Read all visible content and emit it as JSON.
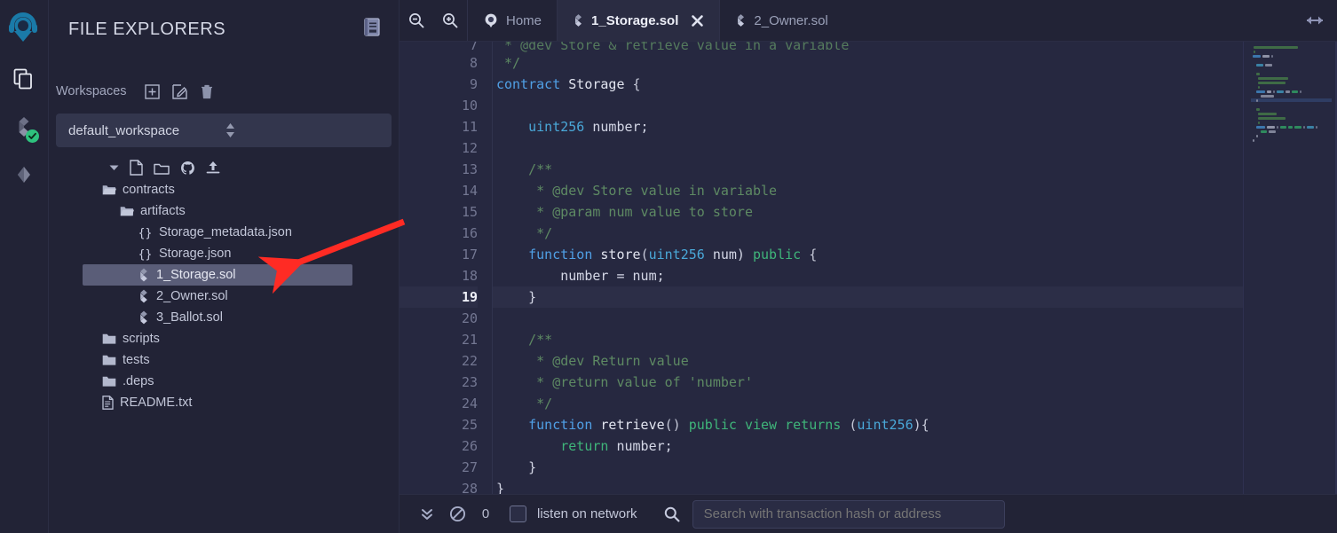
{
  "app": {
    "logo_icon": "remix-logo-icon",
    "accent_color": "#1a7aa8",
    "bg_color": "#222336",
    "editor_bg": "#262840",
    "selected_row_color": "#5a5d78",
    "annotation_arrow_color": "#ff2b24"
  },
  "iconbar": {
    "items": [
      {
        "name": "file-explorers-icon",
        "icon": "files-icon",
        "active": true,
        "badge": null
      },
      {
        "name": "solidity-compiler-icon",
        "icon": "solidity-icon",
        "active": false,
        "badge": "check"
      },
      {
        "name": "deploy-run-transactions-icon",
        "icon": "ethereum-icon",
        "active": false,
        "badge": null
      }
    ]
  },
  "explorer": {
    "title": "FILE EXPLORERS",
    "header_icon": "documentation-book-icon",
    "workspaces_label": "Workspaces",
    "workspace_actions": [
      {
        "name": "create-workspace-button",
        "icon": "plus-square-icon"
      },
      {
        "name": "rename-workspace-button",
        "icon": "pencil-square-icon"
      },
      {
        "name": "delete-workspace-button",
        "icon": "trash-icon"
      }
    ],
    "selected_workspace": "default_workspace",
    "tree_toolbar": [
      {
        "name": "new-file-button",
        "icon": "file-icon"
      },
      {
        "name": "new-folder-button",
        "icon": "folder-icon"
      },
      {
        "name": "connect-github-button",
        "icon": "github-icon"
      },
      {
        "name": "publish-to-gist-button",
        "icon": "upload-icon"
      }
    ],
    "tree": [
      {
        "label": "contracts",
        "type": "folder-open",
        "indent": 1,
        "selected": false
      },
      {
        "label": "artifacts",
        "type": "folder-open",
        "indent": 2,
        "selected": false
      },
      {
        "label": "Storage_metadata.json",
        "type": "json",
        "indent": 3,
        "selected": false
      },
      {
        "label": "Storage.json",
        "type": "json",
        "indent": 3,
        "selected": false
      },
      {
        "label": "1_Storage.sol",
        "type": "solidity",
        "indent": 3,
        "selected": true
      },
      {
        "label": "2_Owner.sol",
        "type": "solidity",
        "indent": 3,
        "selected": false
      },
      {
        "label": "3_Ballot.sol",
        "type": "solidity",
        "indent": 3,
        "selected": false
      },
      {
        "label": "scripts",
        "type": "folder",
        "indent": 1,
        "selected": false
      },
      {
        "label": "tests",
        "type": "folder",
        "indent": 1,
        "selected": false
      },
      {
        "label": ".deps",
        "type": "folder",
        "indent": 1,
        "selected": false
      },
      {
        "label": "README.txt",
        "type": "file",
        "indent": 1,
        "selected": false
      }
    ]
  },
  "tabbar": {
    "zoom_out_icon": "zoom-out-icon",
    "zoom_in_icon": "zoom-in-icon",
    "resize_icon": "horizontal-resize-icon",
    "tabs": [
      {
        "label": "Home",
        "icon": "home-icon",
        "active": false,
        "closable": false
      },
      {
        "label": "1_Storage.sol",
        "icon": "solidity-icon",
        "active": true,
        "closable": true
      },
      {
        "label": "2_Owner.sol",
        "icon": "solidity-icon",
        "active": false,
        "closable": false
      }
    ]
  },
  "editor": {
    "current_line": 19,
    "first_visible_line": 7,
    "lines": [
      {
        "n": 7,
        "partial": true,
        "tokens": [
          {
            "t": " * @dev Store & retrieve value in a variable",
            "c": "c-com"
          }
        ]
      },
      {
        "n": 8,
        "tokens": [
          {
            "t": " */",
            "c": "c-com"
          }
        ]
      },
      {
        "n": 9,
        "tokens": [
          {
            "t": "contract",
            "c": "c-kw"
          },
          {
            "t": " ",
            "c": "c-id"
          },
          {
            "t": "Storage",
            "c": "c-fn"
          },
          {
            "t": " {",
            "c": "c-pun"
          }
        ]
      },
      {
        "n": 10,
        "tokens": []
      },
      {
        "n": 11,
        "tokens": [
          {
            "t": "    ",
            "c": "c-id"
          },
          {
            "t": "uint256",
            "c": "c-type"
          },
          {
            "t": " number;",
            "c": "c-id"
          }
        ]
      },
      {
        "n": 12,
        "tokens": []
      },
      {
        "n": 13,
        "tokens": [
          {
            "t": "    /**",
            "c": "c-com"
          }
        ]
      },
      {
        "n": 14,
        "tokens": [
          {
            "t": "     * @dev Store value in variable",
            "c": "c-com"
          }
        ]
      },
      {
        "n": 15,
        "tokens": [
          {
            "t": "     * @param num value to store",
            "c": "c-com"
          }
        ]
      },
      {
        "n": 16,
        "tokens": [
          {
            "t": "     */",
            "c": "c-com"
          }
        ]
      },
      {
        "n": 17,
        "tokens": [
          {
            "t": "    ",
            "c": "c-id"
          },
          {
            "t": "function",
            "c": "c-kw"
          },
          {
            "t": " ",
            "c": "c-id"
          },
          {
            "t": "store",
            "c": "c-fn"
          },
          {
            "t": "(",
            "c": "c-pun"
          },
          {
            "t": "uint256",
            "c": "c-type"
          },
          {
            "t": " num) ",
            "c": "c-id"
          },
          {
            "t": "public",
            "c": "c-mod"
          },
          {
            "t": " {",
            "c": "c-pun"
          }
        ]
      },
      {
        "n": 18,
        "tokens": [
          {
            "t": "        number = num;",
            "c": "c-id"
          }
        ]
      },
      {
        "n": 19,
        "tokens": [
          {
            "t": "    }",
            "c": "c-id"
          }
        ]
      },
      {
        "n": 20,
        "tokens": []
      },
      {
        "n": 21,
        "tokens": [
          {
            "t": "    /**",
            "c": "c-com"
          }
        ]
      },
      {
        "n": 22,
        "tokens": [
          {
            "t": "     * @dev Return value",
            "c": "c-com"
          }
        ]
      },
      {
        "n": 23,
        "tokens": [
          {
            "t": "     * @return value of 'number'",
            "c": "c-com"
          }
        ]
      },
      {
        "n": 24,
        "tokens": [
          {
            "t": "     */",
            "c": "c-com"
          }
        ]
      },
      {
        "n": 25,
        "tokens": [
          {
            "t": "    ",
            "c": "c-id"
          },
          {
            "t": "function",
            "c": "c-kw"
          },
          {
            "t": " ",
            "c": "c-id"
          },
          {
            "t": "retrieve",
            "c": "c-fn"
          },
          {
            "t": "() ",
            "c": "c-pun"
          },
          {
            "t": "public",
            "c": "c-mod"
          },
          {
            "t": " ",
            "c": "c-id"
          },
          {
            "t": "view",
            "c": "c-mod"
          },
          {
            "t": " ",
            "c": "c-id"
          },
          {
            "t": "returns",
            "c": "c-mod"
          },
          {
            "t": " (",
            "c": "c-pun"
          },
          {
            "t": "uint256",
            "c": "c-type"
          },
          {
            "t": "){",
            "c": "c-pun"
          }
        ]
      },
      {
        "n": 26,
        "tokens": [
          {
            "t": "        ",
            "c": "c-id"
          },
          {
            "t": "return",
            "c": "c-mod"
          },
          {
            "t": " number;",
            "c": "c-id"
          }
        ]
      },
      {
        "n": 27,
        "tokens": [
          {
            "t": "    }",
            "c": "c-id"
          }
        ]
      },
      {
        "n": 28,
        "tokens": [
          {
            "t": "}",
            "c": "c-id"
          }
        ]
      }
    ]
  },
  "terminal": {
    "toggle_icon": "double-chevron-down-icon",
    "clear_icon": "ban-circle-icon",
    "count": "0",
    "listen_label": "listen on network",
    "listen_checked": false,
    "search_icon": "search-icon",
    "search_placeholder": "Search with transaction hash or address",
    "search_value": ""
  }
}
